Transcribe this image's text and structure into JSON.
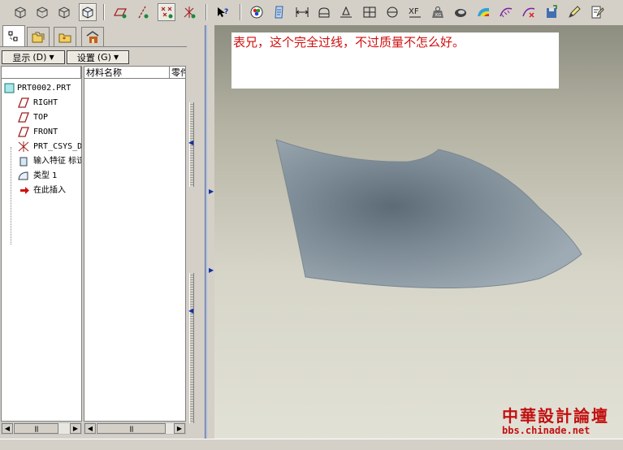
{
  "toolbar": {
    "buttons": [
      {
        "name": "shading-display-icon"
      },
      {
        "name": "hidden-line-icon"
      },
      {
        "name": "no-hidden-icon"
      },
      {
        "name": "wireframe-icon"
      },
      {
        "name": "datum-planes-toggle-icon"
      },
      {
        "name": "datum-axes-toggle-icon"
      },
      {
        "name": "datum-points-toggle-icon"
      },
      {
        "name": "coordinate-systems-toggle-icon"
      },
      {
        "name": "context-help-icon"
      },
      {
        "name": "color-appearance-icon"
      },
      {
        "name": "model-setup-icon"
      },
      {
        "name": "measure-distance-icon"
      },
      {
        "name": "measure-area-icon"
      },
      {
        "name": "measure-angle-icon"
      },
      {
        "name": "section-icon"
      },
      {
        "name": "curvature-icon"
      },
      {
        "name": "xf-analysis-icon"
      },
      {
        "name": "mass-properties-icon"
      },
      {
        "name": "surface-analysis-icon"
      },
      {
        "name": "shaded-curvature-icon"
      },
      {
        "name": "curve-analysis-icon"
      },
      {
        "name": "deviation-icon"
      },
      {
        "name": "save-analysis-icon"
      },
      {
        "name": "edit-icon"
      },
      {
        "name": "redefine-icon"
      }
    ]
  },
  "panel_tabs": [
    {
      "name": "model-tree-tab-icon"
    },
    {
      "name": "folder-browser-tab-icon"
    },
    {
      "name": "favorites-tab-icon"
    },
    {
      "name": "connections-tab-icon"
    }
  ],
  "panel": {
    "show_label": "显示",
    "show_key": "(D)",
    "settings_label": "设置",
    "settings_key": "(G)"
  },
  "tree": {
    "root": "PRT0002.PRT",
    "items": [
      {
        "label": "RIGHT",
        "icon": "datum-plane-icon"
      },
      {
        "label": "TOP",
        "icon": "datum-plane-icon"
      },
      {
        "label": "FRONT",
        "icon": "datum-plane-icon"
      },
      {
        "label": "PRT_CSYS_DEF",
        "icon": "csys-icon"
      },
      {
        "label": "输入特征 标识",
        "icon": "import-feature-icon"
      },
      {
        "label": "类型 1",
        "icon": "surface-type-icon"
      },
      {
        "label": "在此插入",
        "icon": "insert-here-arrow-icon"
      }
    ]
  },
  "columns": {
    "material": "材料名称",
    "part": "零件"
  },
  "viewport": {
    "note": "表兄，这个完全过线，不过质量不怎么好。"
  },
  "watermark": {
    "title": "中華設計論壇",
    "url": "bbs.chinade.net"
  },
  "colors": {
    "surface": "#8e9aa3",
    "note_text": "#d01010",
    "watermark": "#c21010"
  }
}
